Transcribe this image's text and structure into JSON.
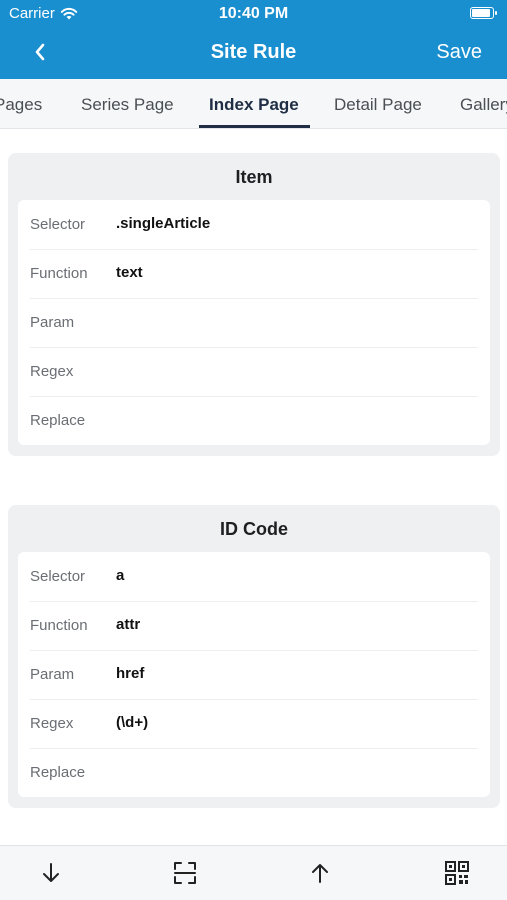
{
  "status_bar": {
    "carrier": "Carrier",
    "time": "10:40 PM"
  },
  "nav": {
    "title": "Site Rule",
    "save_label": "Save"
  },
  "tabs": [
    {
      "label": "Pages"
    },
    {
      "label": "Series Page"
    },
    {
      "label": "Index Page",
      "active": true
    },
    {
      "label": "Detail Page"
    },
    {
      "label": "Gallery"
    }
  ],
  "sections": [
    {
      "title": "Item",
      "rows": [
        {
          "label": "Selector",
          "value": ".singleArticle"
        },
        {
          "label": "Function",
          "value": "text"
        },
        {
          "label": "Param",
          "value": ""
        },
        {
          "label": "Regex",
          "value": ""
        },
        {
          "label": "Replace",
          "value": ""
        }
      ]
    },
    {
      "title": "ID Code",
      "rows": [
        {
          "label": "Selector",
          "value": "a"
        },
        {
          "label": "Function",
          "value": "attr"
        },
        {
          "label": "Param",
          "value": "href"
        },
        {
          "label": "Regex",
          "value": "(\\d+)"
        },
        {
          "label": "Replace",
          "value": ""
        }
      ]
    }
  ],
  "toolbar": {
    "icons": [
      "arrow-down-icon",
      "scan-frame-icon",
      "arrow-up-icon",
      "qr-code-icon"
    ]
  },
  "colors": {
    "accent": "#1a8fcf",
    "active_tab": "#1f2e44"
  }
}
